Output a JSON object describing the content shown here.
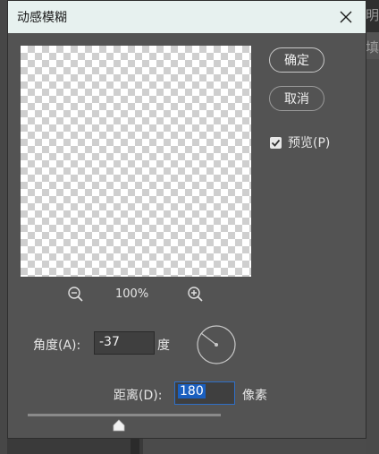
{
  "background": {
    "right_glyphs": [
      "明",
      "填"
    ]
  },
  "dialog": {
    "title": "动感模糊",
    "close_icon": "close-icon"
  },
  "buttons": {
    "ok_label": "确定",
    "cancel_label": "取消"
  },
  "preview": {
    "label": "预览(P)",
    "checked": true
  },
  "zoom": {
    "level": "100%",
    "zoom_out_icon": "zoom-out-icon",
    "zoom_in_icon": "zoom-in-icon"
  },
  "angle": {
    "label": "角度(A):",
    "value": "-37",
    "unit": "度"
  },
  "distance": {
    "label": "距离(D):",
    "value": "180",
    "unit": "像素",
    "slider_fraction": 0.47
  },
  "colors": {
    "titlebar": "#e7f1ef",
    "dialog_bg": "#535353",
    "selection": "#1a5fbf",
    "focus_border": "#2f6fc7"
  }
}
